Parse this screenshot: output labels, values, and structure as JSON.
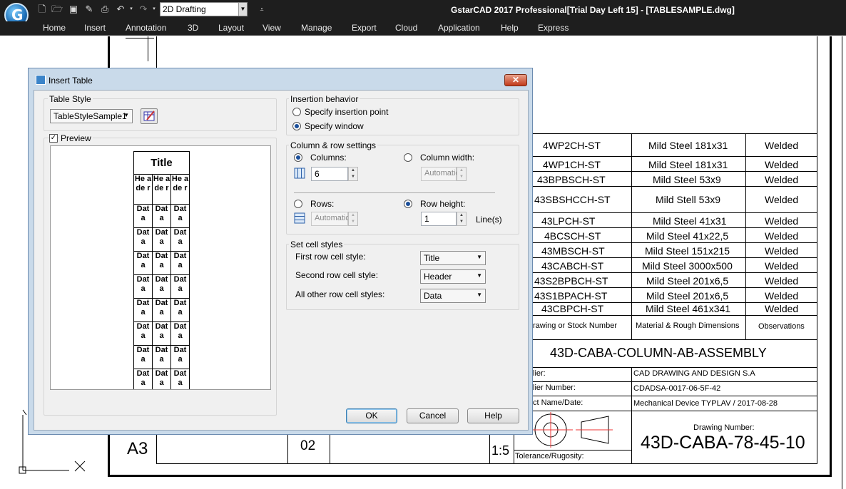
{
  "app": {
    "title": "GstarCAD 2017 Professional[Trial Day Left 15] - [TABLESAMPLE.dwg]",
    "workspace": "2D Drafting",
    "logo_letter": "G"
  },
  "menu": [
    "Home",
    "Insert",
    "Annotation",
    "3D",
    "Layout",
    "View",
    "Manage",
    "Export",
    "Cloud",
    "Application",
    "Help",
    "Express"
  ],
  "drawing": {
    "rows": [
      {
        "part": "4WP2CH-ST",
        "material": "Mild Steel 181x31",
        "obs": "Welded"
      },
      {
        "part": "4WP1CH-ST",
        "material": "Mild Steel 181x31",
        "obs": "Welded"
      },
      {
        "part": "43BPBSCH-ST",
        "material": "Mild Steel 53x9",
        "obs": "Welded"
      },
      {
        "part": "43SBSHCCH-ST",
        "material": "Mild Stell 53x9",
        "obs": "Welded"
      },
      {
        "part": "43LPCH-ST",
        "material": "Mild Steel 41x31",
        "obs": "Welded"
      },
      {
        "part": "4BCSCH-ST",
        "material": "Mild Steel 41x22,5",
        "obs": "Welded"
      },
      {
        "part": "43MBSCH-ST",
        "material": "Mild Steel 151x215",
        "obs": "Welded"
      },
      {
        "part": "43CABCH-ST",
        "material": "Mild Steel 3000x500",
        "obs": "Welded"
      },
      {
        "part": "43S2BPBCH-ST",
        "material": "Mild Steel 201x6,5",
        "obs": "Welded"
      },
      {
        "part": "43S1BPACH-ST",
        "material": "Mild Steel 201x6,5",
        "obs": "Welded"
      },
      {
        "part": "43CBPCH-ST",
        "material": "Mild Steel 461x341",
        "obs": "Welded"
      }
    ],
    "headers": {
      "part": "rawing or Stock Number",
      "material": "Material & Rough Dimensions",
      "obs": "Observations"
    },
    "assembly_title": "43D-CABA-COLUMN-AB-ASSEMBLY",
    "supplier_label": "lier:",
    "supplier_value": "CAD DRAWING AND DESIGN S.A",
    "supplier_number_label": "lier Number:",
    "supplier_number_value": "CDADSA-0017-06-5F-42",
    "project_label": "ct Name/Date:",
    "project_value": "Mechanical Device TYPLAV / 2017-08-28",
    "drawing_number_label": "Drawing Number:",
    "drawing_number_value": "43D-CABA-78-45-10",
    "tolerance_label": "Tolerance/Rugosity:",
    "sheet_size": "A3",
    "sheet_no": "02",
    "scale": "1:5"
  },
  "dialog": {
    "title": "Insert Table",
    "close": "✕",
    "table_style_group": "Table Style",
    "table_style_value": "TableStyleSample1",
    "preview_label": "Preview",
    "preview_checked": "✓",
    "preview": {
      "title": "Title",
      "header": "He ade r",
      "data": "Dat a"
    },
    "insertion_group": "Insertion behavior",
    "insertion_point": "Specify insertion point",
    "insertion_window": "Specify window",
    "colrow_group": "Column & row settings",
    "columns_label": "Columns:",
    "columns_value": "6",
    "column_width_label": "Column width:",
    "column_width_value": "Automatic",
    "rows_label": "Rows:",
    "rows_value": "Automatic",
    "row_height_label": "Row height:",
    "row_height_value": "1",
    "lines_label": "Line(s)",
    "cellstyle_group": "Set cell styles",
    "first_row_label": "First row cell style:",
    "first_row_value": "Title",
    "second_row_label": "Second row cell style:",
    "second_row_value": "Header",
    "other_rows_label": "All other row cell styles:",
    "other_rows_value": "Data",
    "ok": "OK",
    "cancel": "Cancel",
    "help": "Help"
  }
}
